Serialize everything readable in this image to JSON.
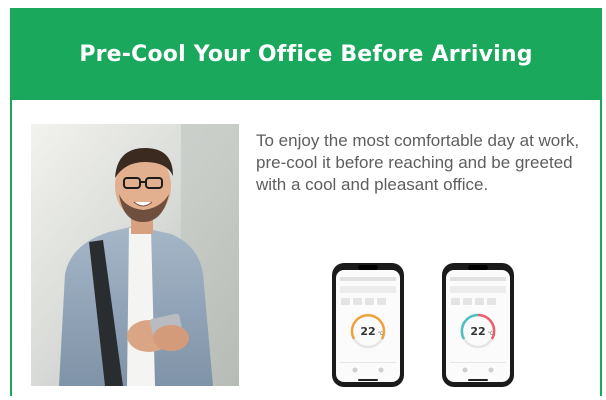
{
  "banner": {
    "title": "Pre-Cool Your Office Before Arriving"
  },
  "description": "To enjoy the most comfortable day at work, pre-cool it before reaching and be greeted with a cool and pleasant office.",
  "phones": [
    {
      "temperature": "22",
      "unit": "°C"
    },
    {
      "temperature": "22",
      "unit": "°C"
    }
  ],
  "colors": {
    "brand_green": "#1aa85c",
    "text_gray": "#5e5e5e",
    "dial_orange": "#f0a23a",
    "dial_teal": "#4cc1c0"
  }
}
